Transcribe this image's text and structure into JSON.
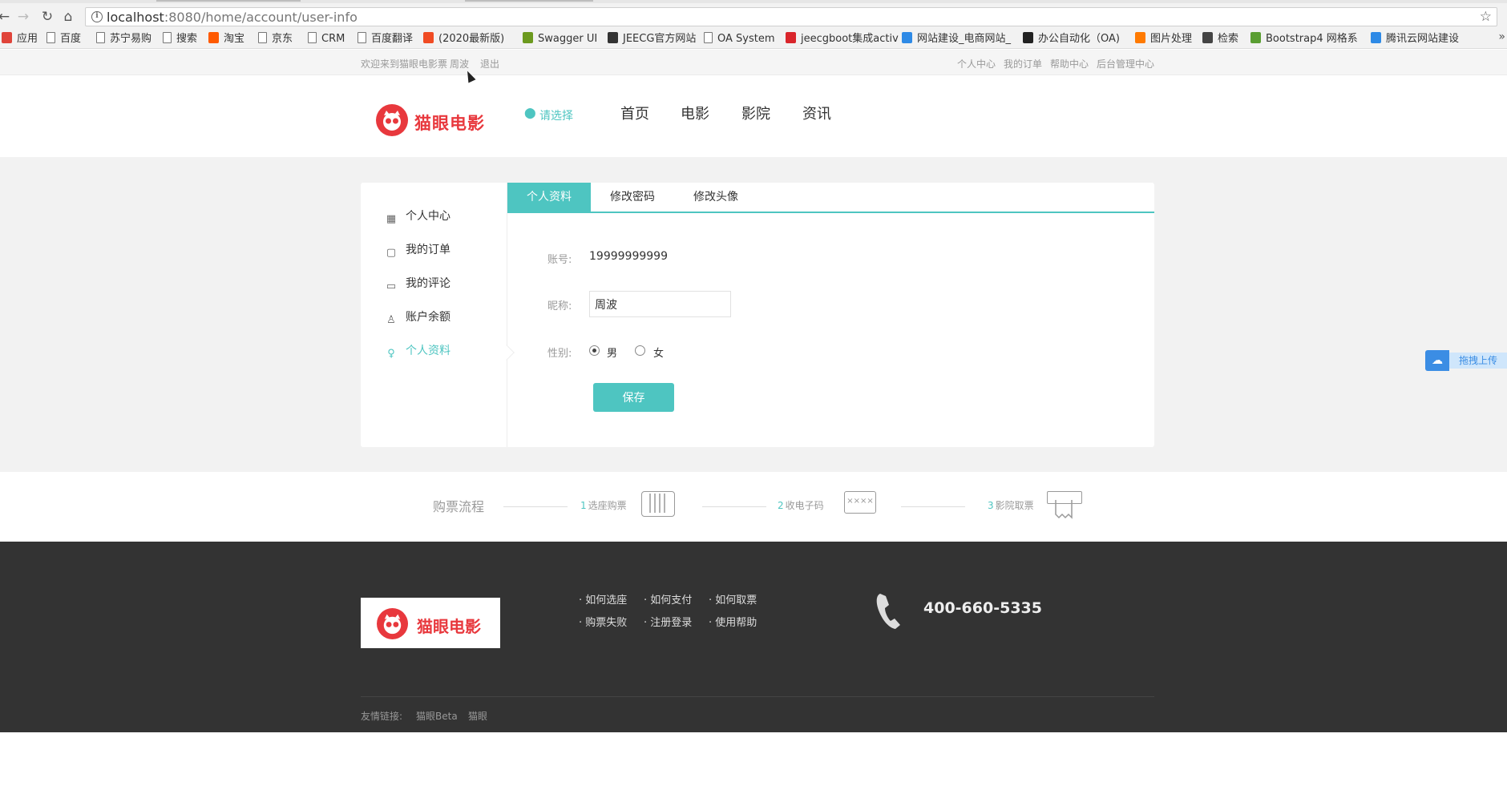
{
  "browser": {
    "url_host": "localhost",
    "url_rest": ":8080/home/account/user-info",
    "bookmarks": [
      {
        "label": "应用",
        "color": "#e0443a"
      },
      {
        "label": "百度",
        "color": "page"
      },
      {
        "label": "苏宁易购",
        "color": "page"
      },
      {
        "label": "搜索",
        "color": "page"
      },
      {
        "label": "淘宝",
        "color": "#ff5a00"
      },
      {
        "label": "京东",
        "color": "page"
      },
      {
        "label": "CRM",
        "color": "page"
      },
      {
        "label": "百度翻译",
        "color": "page"
      },
      {
        "label": "(2020最新版)",
        "color": "#f04b23"
      },
      {
        "label": "Swagger UI",
        "color": "#6c9a1f"
      },
      {
        "label": "JEECG官方网站",
        "color": "#333333"
      },
      {
        "label": "OA System",
        "color": "page"
      },
      {
        "label": "jeecgboot集成activ",
        "color": "#d9252b"
      },
      {
        "label": "网站建设_电商网站_",
        "color": "#2e8ae6"
      },
      {
        "label": "办公自动化（OA)",
        "color": "#222222"
      },
      {
        "label": "图片处理",
        "color": "#ff7a00"
      },
      {
        "label": "检索",
        "color": "#444444"
      },
      {
        "label": "Bootstrap4 网格系",
        "color": "#5a9e32"
      },
      {
        "label": "腾讯云网站建设",
        "color": "#2e8ae6"
      }
    ],
    "more": "»"
  },
  "topbar": {
    "welcome": "欢迎来到猫眼电影票",
    "username": "周波",
    "logout": "退出",
    "links": [
      "个人中心",
      "我的订单",
      "帮助中心",
      "后台管理中心"
    ]
  },
  "header": {
    "logo_text": "猫眼电影",
    "city": "请选择",
    "nav": [
      "首页",
      "电影",
      "影院",
      "资讯"
    ]
  },
  "sidebar": {
    "items": [
      {
        "label": "个人中心",
        "icon": "grid-icon"
      },
      {
        "label": "我的订单",
        "icon": "bag-icon"
      },
      {
        "label": "我的评论",
        "icon": "comment-icon"
      },
      {
        "label": "账户余额",
        "icon": "wallet-icon"
      },
      {
        "label": "个人资料",
        "icon": "user-icon"
      }
    ],
    "active_index": 4
  },
  "tabs": [
    "个人资料",
    "修改密码",
    "修改头像"
  ],
  "form": {
    "account_label": "账号:",
    "account_value": "19999999999",
    "nickname_label": "昵称:",
    "nickname_value": "周波",
    "gender_label": "性别:",
    "gender_male": "男",
    "gender_female": "女",
    "gender_selected": "男",
    "save_label": "保存"
  },
  "float_upload": {
    "label": "拖拽上传"
  },
  "process": {
    "title": "购票流程",
    "steps": [
      {
        "num": "1",
        "label": "选座购票"
      },
      {
        "num": "2",
        "label": "收电子码"
      },
      {
        "num": "3",
        "label": "影院取票"
      }
    ],
    "code_placeholder": "××××"
  },
  "footer": {
    "logo_text": "猫眼电影",
    "help_links": [
      "如何选座",
      "如何支付",
      "如何取票",
      "购票失败",
      "注册登录",
      "使用帮助"
    ],
    "phone": "400-660-5335",
    "friend_label": "友情链接:",
    "friend_links": [
      "猫眼Beta",
      "猫眼"
    ]
  },
  "colors": {
    "accent": "#4ec5c1",
    "brand": "#e8383d",
    "footer_bg": "#333333"
  }
}
